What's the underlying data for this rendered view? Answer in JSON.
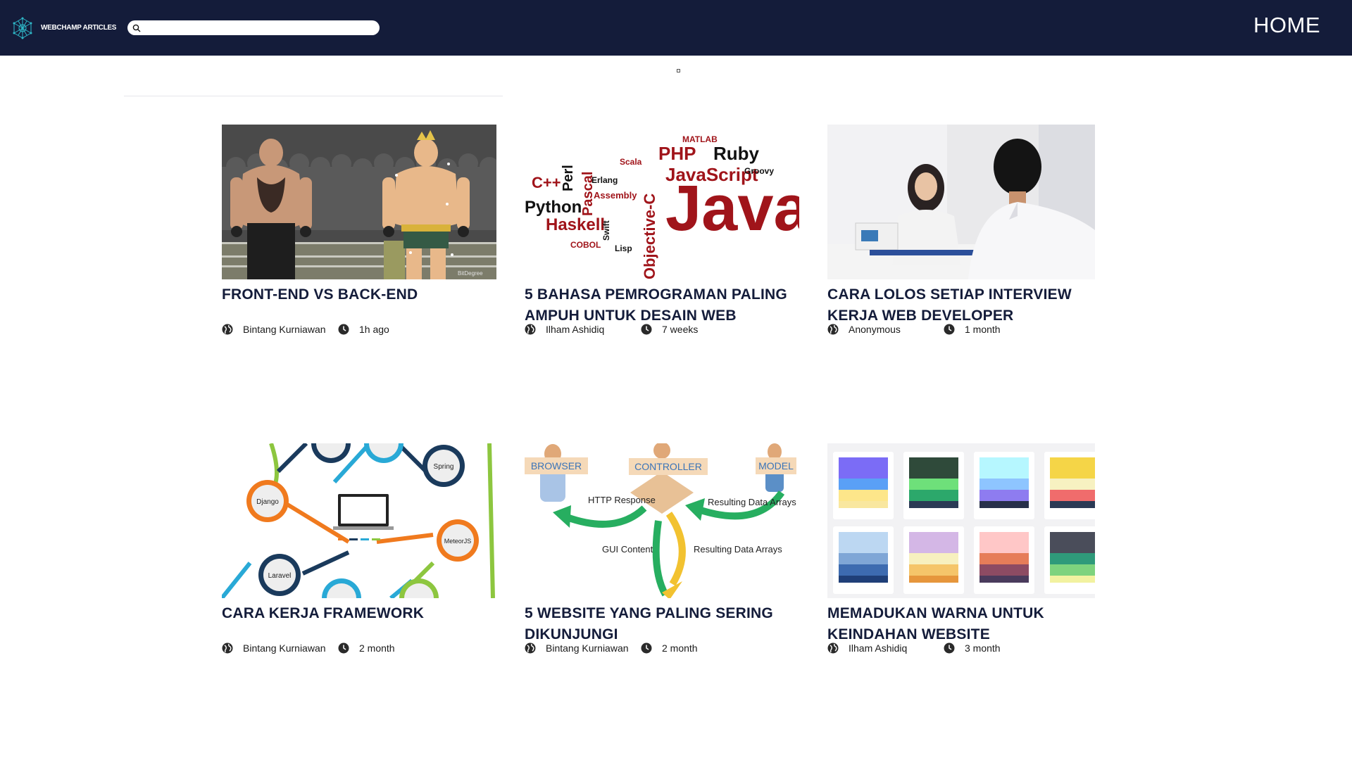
{
  "navbar": {
    "brand": "WEBCHAMP ARTICLES",
    "search_placeholder": "",
    "home_link": "HOME"
  },
  "articles": [
    {
      "title": "FRONT-END VS BACK-END",
      "author": "Bintang Kurniawan",
      "time": "1h ago",
      "image": "wrestlers-illustration",
      "watermark": "BitDegree"
    },
    {
      "title": "5 BAHASA PEMROGRAMAN PALING AMPUH UNTUK DESAIN WEB",
      "author": "Ilham Ashidiq",
      "time": "7 weeks",
      "image": "programming-languages-word-cloud",
      "words": [
        "Java",
        "JavaScript",
        "Python",
        "Haskell",
        "Pascal",
        "PHP",
        "Ruby",
        "Perl",
        "C++",
        "Objective-C",
        "Scala",
        "Assembly",
        "Lisp",
        "COBOL",
        "Erlang",
        "Swift",
        "MATLAB",
        "Groovy"
      ]
    },
    {
      "title": "CARA LOLOS SETIAP INTERVIEW KERJA WEB DEVELOPER",
      "author": "Anonymous",
      "time": "1 month",
      "image": "job-interview-photo"
    },
    {
      "title": "CARA KERJA FRAMEWORK",
      "author": "Bintang Kurniawan",
      "time": "2 month",
      "image": "framework-diagram",
      "labels": [
        "Spring",
        "Django",
        "MeteorJS",
        "Laravel"
      ]
    },
    {
      "title": "5 WEBSITE YANG PALING SERING DIKUNJUNGI",
      "author": "Bintang Kurniawan",
      "time": "2 month",
      "image": "mvc-diagram",
      "labels": [
        "BROWSER",
        "CONTROLLER",
        "MODEL",
        "HTTP Response",
        "Resulting Data Arrays",
        "GUI Content",
        "Resulting Data Arrays"
      ]
    },
    {
      "title": "MEMADUKAN WARNA UNTUK KEINDAHAN WEBSITE",
      "author": "Ilham Ashidiq",
      "time": "3 month",
      "image": "color-palettes",
      "palettes": [
        [
          "#7b6cf6",
          "#5aa0f6",
          "#fde68a",
          "#f9e79f"
        ],
        [
          "#2f4a3a",
          "#6ee07a",
          "#2ca86b",
          "#2b3a55"
        ],
        [
          "#b6f7ff",
          "#8ec5ff",
          "#8e7cf0",
          "#27304a"
        ],
        [
          "#f5d547",
          "#f7f1c1",
          "#f06c6c",
          "#2b3a55"
        ],
        [
          "#bcd7f2",
          "#7fa6d6",
          "#3d6bb0",
          "#1f3f78"
        ],
        [
          "#d4b7e6",
          "#f7f0bf",
          "#f5c56a",
          "#e6963c"
        ],
        [
          "#ffc7c7",
          "#e67d59",
          "#8d4b63",
          "#4a3b5c"
        ],
        [
          "#4a4d5a",
          "#2f9a7a",
          "#7ed37e",
          "#f2f2a0"
        ]
      ]
    }
  ]
}
